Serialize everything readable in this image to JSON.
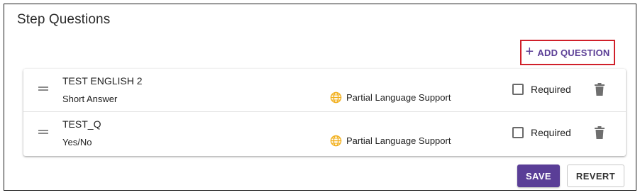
{
  "section": {
    "title": "Step Questions",
    "add_button": {
      "icon": "plus-icon",
      "label": "ADD QUESTION",
      "plus_glyph": "+"
    }
  },
  "questions": [
    {
      "title": "TEST ENGLISH 2",
      "type": "Short Answer",
      "language_support": "Partial Language Support",
      "required_label": "Required",
      "required_checked": false,
      "drag_icon": "drag-handle-icon",
      "delete_icon": "trash-icon"
    },
    {
      "title": "TEST_Q",
      "type": "Yes/No",
      "language_support": "Partial Language Support",
      "required_label": "Required",
      "required_checked": false,
      "drag_icon": "drag-handle-icon",
      "delete_icon": "trash-icon"
    }
  ],
  "actions": {
    "save_label": "SAVE",
    "revert_label": "REVERT"
  },
  "colors": {
    "accent": "#5a3e97",
    "highlight_border": "#d0202a",
    "globe": "#f2b01e"
  }
}
